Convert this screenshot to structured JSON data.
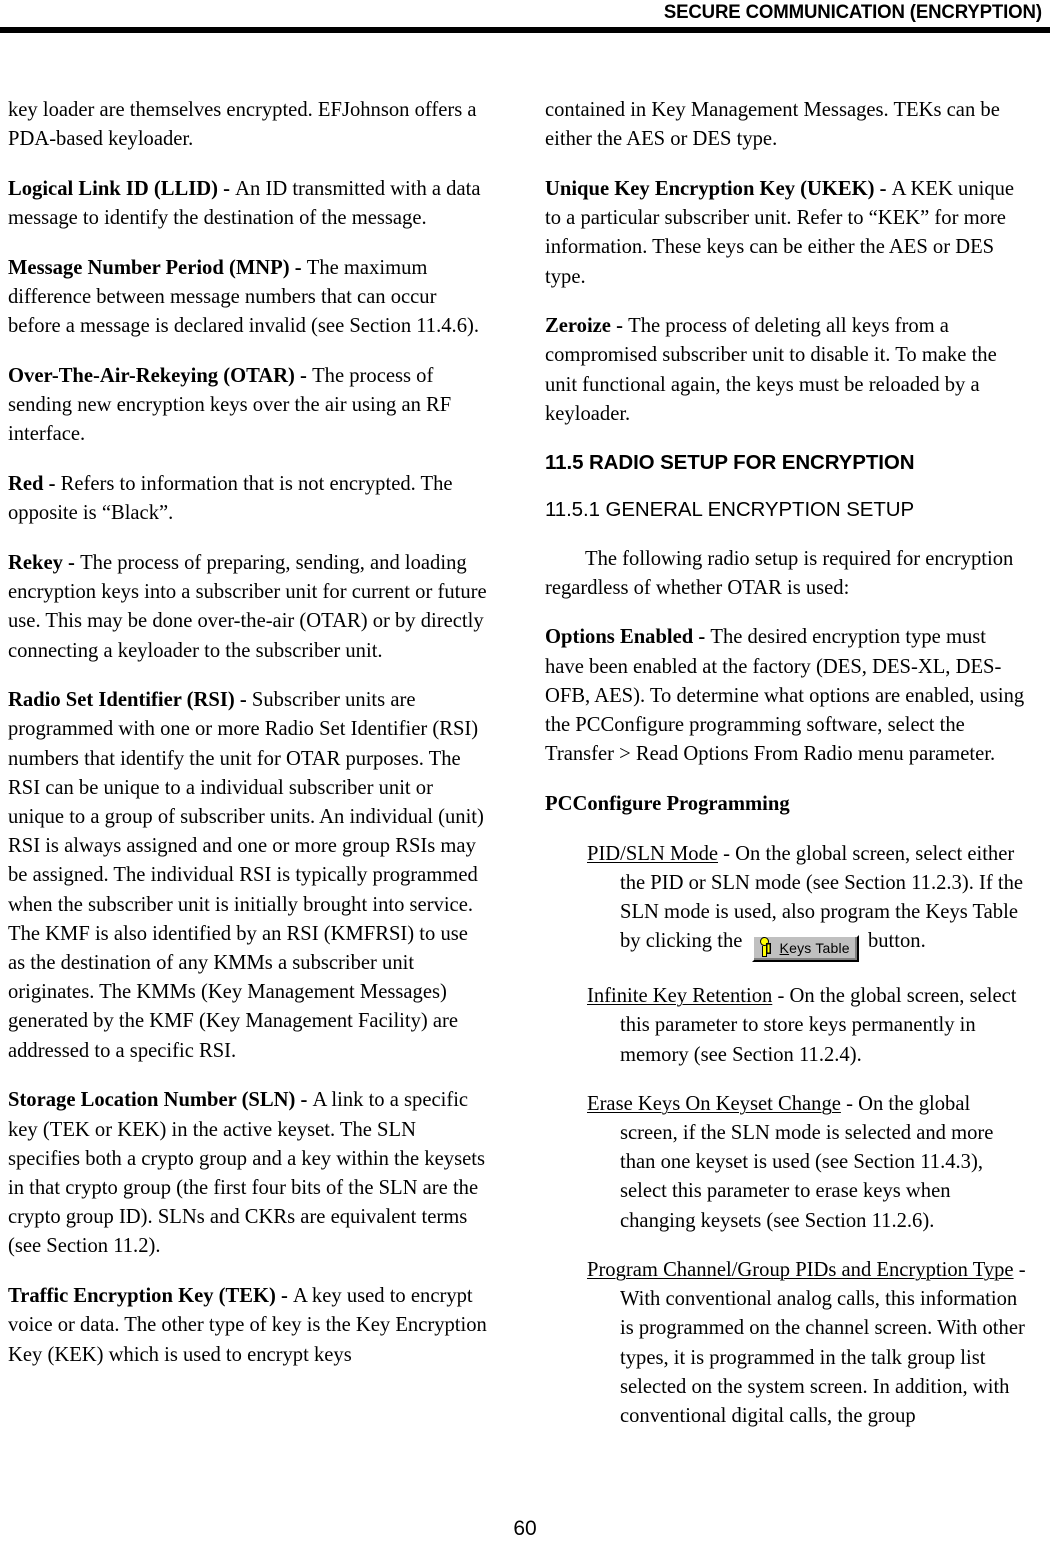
{
  "header": {
    "title": "SECURE COMMUNICATION (ENCRYPTION)"
  },
  "footer": {
    "page_number": "60"
  },
  "left_column": {
    "paragraphs": [
      {
        "id": "keyloader-continuation",
        "term": "",
        "text": "key loader are themselves encrypted. EFJohnson offers a PDA-based keyloader."
      },
      {
        "id": "logical-link-id",
        "term": "Logical Link ID (LLID) - ",
        "text": "An ID transmitted with a data message to identify the destination of the message."
      },
      {
        "id": "message-number-period",
        "term": "Message Number Period (MNP) - ",
        "text": "The maximum difference between message numbers that can occur before a message is declared invalid (see Section 11.4.6)."
      },
      {
        "id": "over-the-air-rekeying",
        "term": "Over-The-Air-Rekeying (OTAR) - ",
        "text": "The process of sending new encryption keys over the air using an RF interface."
      },
      {
        "id": "red",
        "term": "Red - ",
        "text": "Refers to information that is not encrypted. The opposite is “Black”."
      },
      {
        "id": "rekey",
        "term": "Rekey - ",
        "text": "The process of preparing, sending, and loading encryption keys into a subscriber unit for current or future use. This may be done over-the-air (OTAR) or by directly connecting a keyloader to the subscriber unit."
      },
      {
        "id": "radio-set-identifier",
        "term": "Radio Set Identifier (RSI) - ",
        "text": "Subscriber units are programmed with one or more Radio Set Identifier (RSI) numbers that identify the unit for OTAR purposes. The RSI can be unique to a individual subscriber unit or unique to a group of subscriber units. An individual (unit) RSI is always assigned and one or more group RSIs may be assigned. The individual RSI is typically programmed when the subscriber unit is initially brought into service. The KMF is also identified by an RSI (KMFRSI) to use as the destination of any KMMs a subscriber unit originates. The KMMs (Key Management Messages) generated by the KMF (Key Management Facility) are addressed to a specific RSI."
      },
      {
        "id": "storage-location-number",
        "term": "Storage Location Number (SLN) - ",
        "text": "A link to a specific key (TEK or KEK) in the active keyset. The SLN specifies both a crypto group and a key within the keysets in that crypto group (the first four bits of the SLN are the crypto group ID). SLNs and CKRs are equivalent terms (see Section 11.2)."
      },
      {
        "id": "traffic-encryption-key",
        "term": "Traffic Encryption Key (TEK) - ",
        "text": "A key used to encrypt voice or data. The other type of key is the Key Encryption Key (KEK) which is used to encrypt keys"
      }
    ]
  },
  "right_column": {
    "paragraphs_top": [
      {
        "id": "tek-continuation",
        "term": "",
        "text": "contained in Key Management Messages. TEKs can be either the AES or DES type."
      },
      {
        "id": "unique-key-encryption-key",
        "term": "Unique Key Encryption Key (UKEK) - ",
        "text": "A KEK unique to a particular subscriber unit. Refer to “KEK” for more information. These keys can be either the AES or DES type."
      },
      {
        "id": "zeroize",
        "term": "Zeroize - ",
        "text": "The process of deleting all keys from a compromised subscriber unit to disable it. To make the unit functional again, the keys must be reloaded by a keyloader."
      }
    ],
    "section_heading": "11.5 RADIO SETUP FOR ENCRYPTION",
    "subsection_heading": "11.5.1  GENERAL ENCRYPTION SETUP",
    "intro_paragraph": "The following radio setup is required for encryption regardless of whether OTAR is used:",
    "options_enabled": {
      "term": "Options Enabled - ",
      "text": "The desired encryption type must have been enabled at the factory (DES, DES-XL, DES-OFB, AES). To determine what options are enabled, using the PCConfigure programming software, select the Transfer > Read Options From Radio menu parameter."
    },
    "pcconfigure_heading": "PCConfigure Programming",
    "parameters": [
      {
        "id": "pid-sln-mode",
        "underlined_term": "PID/SLN Mode",
        "text_before_button": " - On the global screen, select either the PID or SLN mode (see Section 11.2.3). If the SLN mode is used, also program the Keys Table by clicking the ",
        "button": {
          "icon": "key-icon",
          "mnemonic": "K",
          "label_rest": "eys Table"
        },
        "text_after_button": " button."
      },
      {
        "id": "infinite-key-retention",
        "underlined_term": "Infinite Key Retention",
        "text_before_button": " - On the global screen, select this parameter to store keys permanently in memory (see Section 11.2.4).",
        "button": null,
        "text_after_button": ""
      },
      {
        "id": "erase-keys-on-keyset-change",
        "underlined_term": "Erase Keys On Keyset Change",
        "text_before_button": " - On the global screen, if the SLN mode is selected and more than one keyset is used (see Section 11.4.3), select this parameter to erase keys when changing keysets (see Section 11.2.6).",
        "button": null,
        "text_after_button": ""
      },
      {
        "id": "program-channel-group-pids",
        "underlined_term": "Program Channel/Group PIDs and Encryption Type",
        "text_before_button": " - With conventional analog calls, this information is programmed on the channel screen. With other types, it is programmed in the talk group list selected on the system screen. In addition, with conventional digital calls, the group",
        "button": null,
        "text_after_button": ""
      }
    ]
  }
}
